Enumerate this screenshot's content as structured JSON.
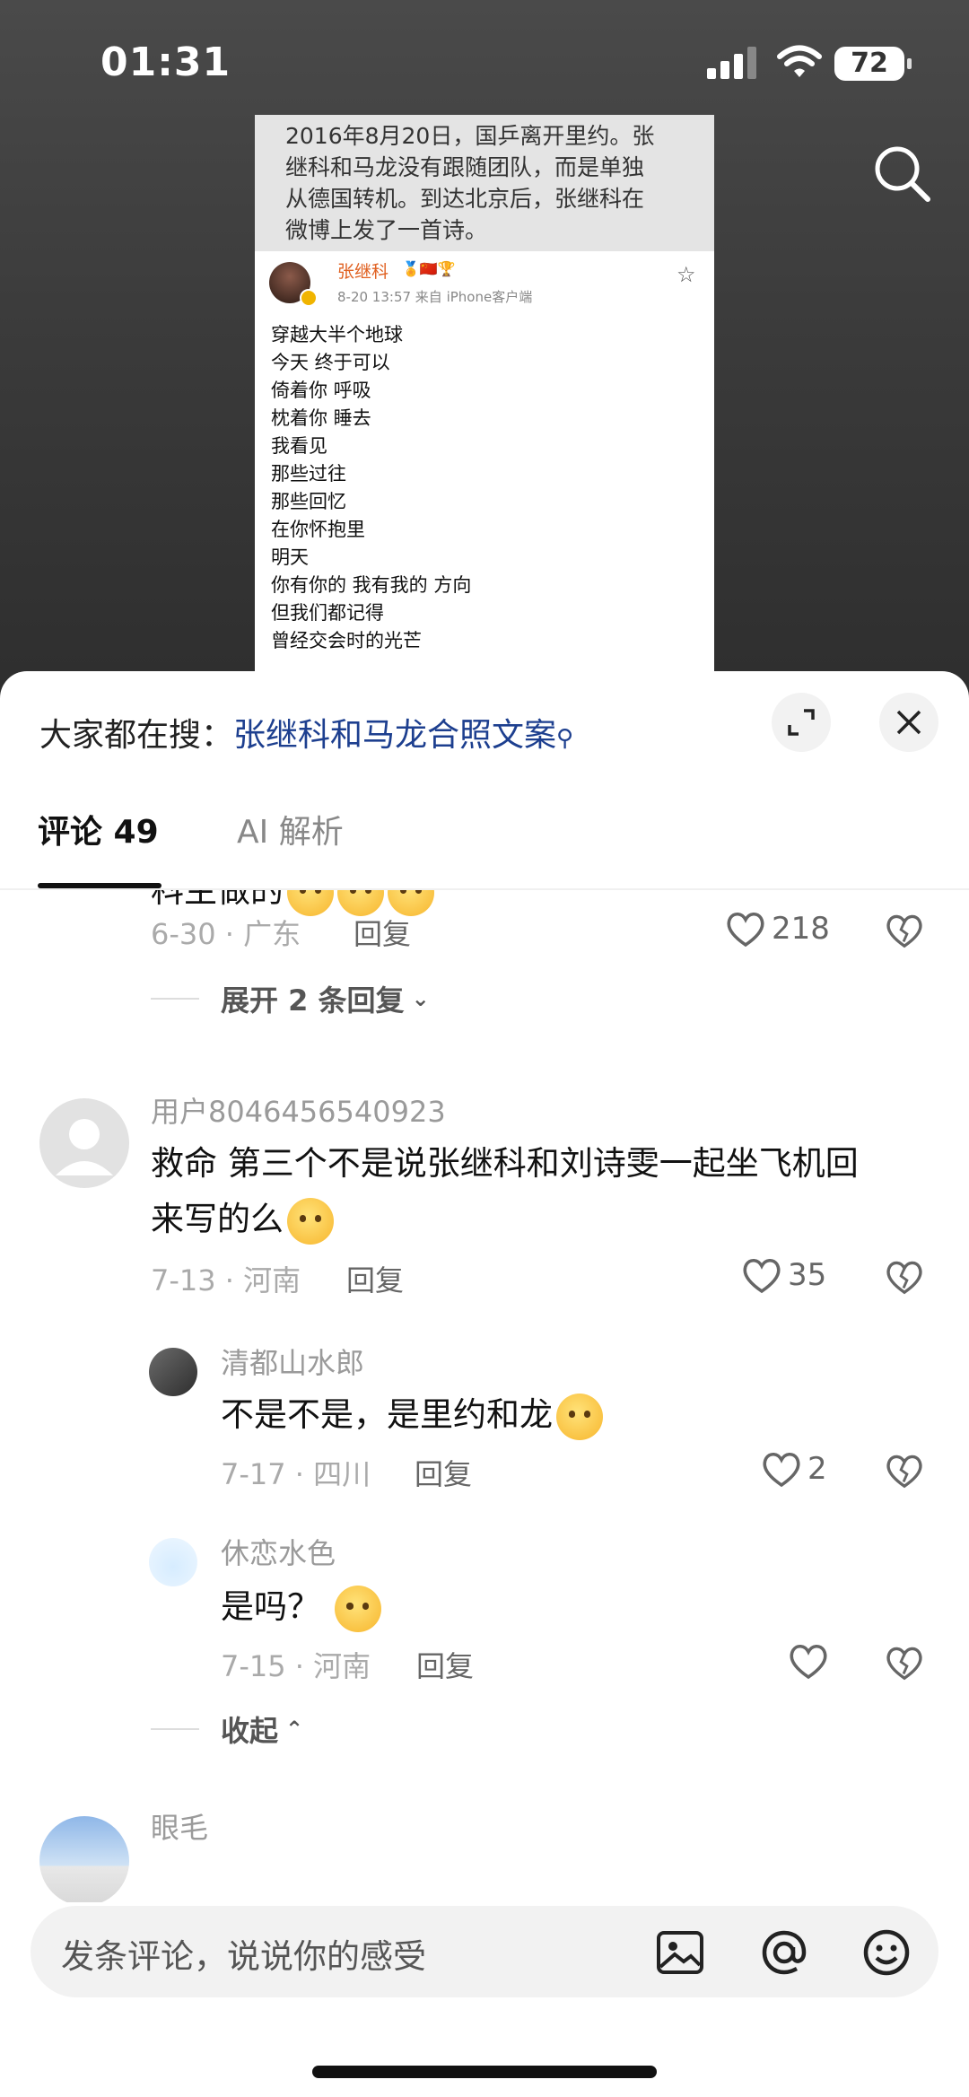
{
  "status_bar": {
    "time": "01:31",
    "battery": "72"
  },
  "doc_image": {
    "caption_lines": [
      "2016年8月20日，国乒离开里约。张",
      "继科和马龙没有跟随团队，而是单独",
      "从德国转机。到达北京后，张继科在",
      "微博上发了一首诗。"
    ],
    "weibo_name": "张继科",
    "weibo_meta": "8-20 13:57 来自 iPhone客户端",
    "poem": [
      "穿越大半个地球",
      "今天 终于可以",
      "倚着你 呼吸",
      "枕着你 睡去",
      "我看见",
      "那些过往",
      "那些回忆",
      "在你怀抱里",
      "明天",
      "你有你的 我有我的 方向",
      "但我们都记得",
      "曾经交会时的光芒",
      "......"
    ]
  },
  "sheet": {
    "hot_search_prefix": "大家都在搜：",
    "hot_search_link": "张继科和马龙合照文案",
    "tabs": {
      "comments": "评论 49",
      "ai": "AI 解析"
    }
  },
  "comments": {
    "partial": {
      "text": "科主做的",
      "meta": "6-30 · 广东",
      "reply": "回复",
      "likes": "218",
      "expand": "展开 2 条回复"
    },
    "c1": {
      "user": "用户8046456540923",
      "line1": "救命 第三个不是说张继科和刘诗雯一起坐飞机回",
      "line2": "来写的么",
      "meta": "7-13 · 河南",
      "reply": "回复",
      "likes": "35"
    },
    "r1": {
      "user": "清都山水郎",
      "text": "不是不是，是里约和龙",
      "meta": "7-17 · 四川",
      "reply": "回复",
      "likes": "2"
    },
    "r2": {
      "user": "休恋水色",
      "text": "是吗？",
      "meta": "7-15 · 河南",
      "reply": "回复",
      "likes": ""
    },
    "collapse": "收起",
    "c2": {
      "user": "眼毛"
    }
  },
  "input": {
    "placeholder": "发条评论，说说你的感受"
  }
}
